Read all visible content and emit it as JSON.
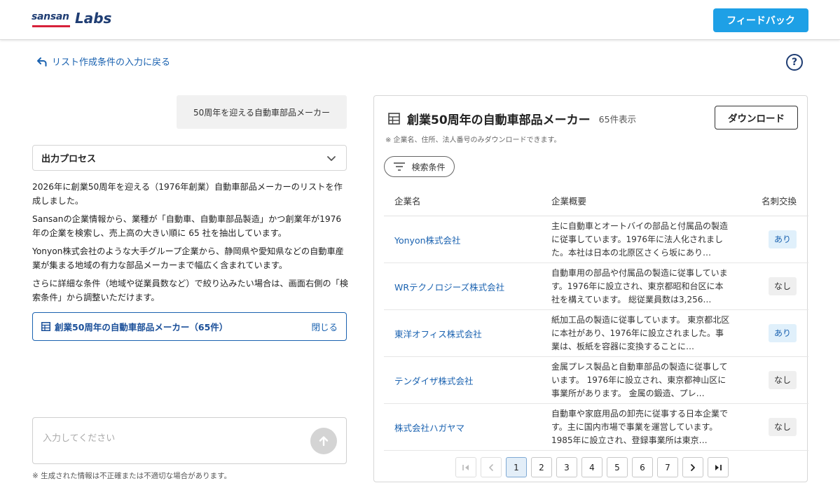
{
  "header": {
    "logo_sansan": "sansan",
    "logo_labs": "Labs",
    "feedback_label": "フィードバック",
    "accent_color": "#1ea0e6"
  },
  "nav": {
    "back_label": "リスト作成条件の入力に戻る",
    "help_label": "?"
  },
  "chat": {
    "user_query": "50周年を迎える自動車部品メーカー",
    "process_title": "出力プロセス",
    "paragraphs": [
      "2026年に創業50周年を迎える（1976年創業）自動車部品メーカーのリストを作成しました。",
      "Sansanの企業情報から、業種が「自動車、自動車部品製造」かつ創業年が1976年の企業を検索し、売上高の大きい順に 65 社を抽出しています。",
      "Yonyon株式会社のような大手グループ企業から、静岡県や愛知県などの自動車産業が集まる地域の有力な部品メーカーまで幅広く含まれています。",
      "さらに詳細な条件（地域や従業員数など）で絞り込みたい場合は、画面右側の「検索条件」から調整いただけます。"
    ],
    "result_link_label": "創業50周年の自動車部品メーカー（65件）",
    "result_close_label": "閉じる",
    "input_placeholder": "入力してください",
    "input_value": "",
    "disclaimer": "※ 生成された情報は不正確または不適切な場合があります。"
  },
  "panel": {
    "title": "創業50周年の自動車部品メーカー",
    "count": "65件表示",
    "download_label": "ダウンロード",
    "note": "※ 企業名、住所、法人番号のみダウンロードできます。",
    "filter_label": "検索条件",
    "columns": [
      "企業名",
      "企業概要",
      "名刺交換"
    ],
    "rows": [
      {
        "name": "Yonyon株式会社",
        "summary": "主に自動車とオートバイの部品と付属品の製造に従事しています。1976年に法人化されました。本社は日本の北原区さくら坂にあり…",
        "card": "あり",
        "has_card": true
      },
      {
        "name": "WRテクノロジーズ株式会社",
        "summary": "自動車用の部品や付属品の製造に従事しています。1976年に設立され、東京都昭和台区に本社を構えています。 総従業員数は3,256…",
        "card": "なし",
        "has_card": false
      },
      {
        "name": "東洋オフィス株式会社",
        "summary": "紙加工品の製造に従事しています。 東京都北区に本社があり、1976年に設立されました。事業は、板紙を容器に変換することに…",
        "card": "あり",
        "has_card": true
      },
      {
        "name": "テンダイザ株式会社",
        "summary": "金属プレス製品と自動車部品の製造に従事しています。 1976年に設立され、東京都神山区に事業所があります。 金属の鍛造、プレ…",
        "card": "なし",
        "has_card": false
      },
      {
        "name": "株式会社ハガヤマ",
        "summary": "自動車や家庭用品の卸売に従事する日本企業です。主に国内市場で事業を運営しています。1985年に設立され、登録事業所は東京…",
        "card": "なし",
        "has_card": false
      }
    ],
    "pagination": {
      "pages": [
        "1",
        "2",
        "3",
        "4",
        "5",
        "6",
        "7"
      ],
      "current": "1"
    }
  }
}
